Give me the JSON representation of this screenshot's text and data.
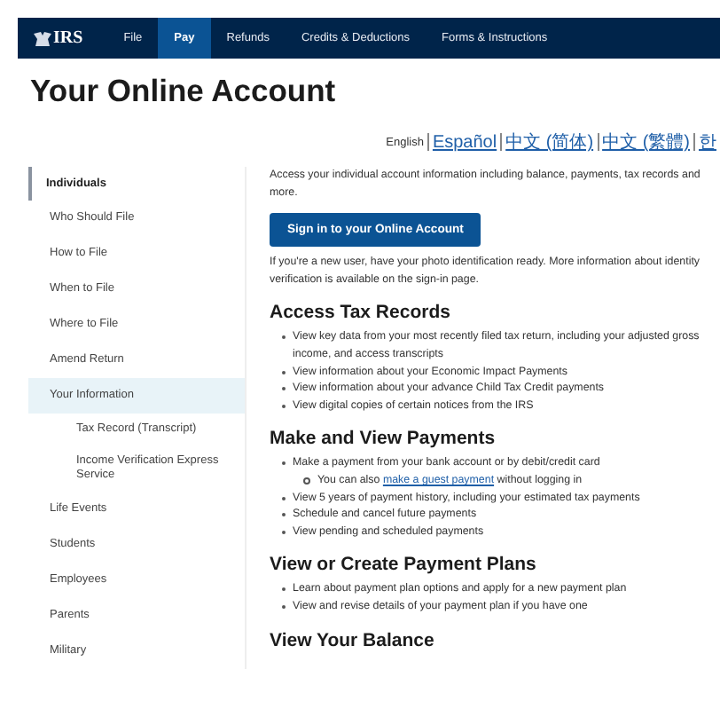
{
  "nav": {
    "logo": "IRS",
    "items": [
      {
        "label": "File",
        "selected": false
      },
      {
        "label": "Pay",
        "selected": true
      },
      {
        "label": "Refunds",
        "selected": false
      },
      {
        "label": "Credits & Deductions",
        "selected": false
      },
      {
        "label": "Forms & Instructions",
        "selected": false
      }
    ]
  },
  "title": "Your Online Account",
  "languages": [
    {
      "label": "English",
      "kind": "current"
    },
    {
      "label": "Español",
      "kind": "link"
    },
    {
      "label": "中文 (简体)",
      "kind": "link"
    },
    {
      "label": "中文 (繁體)",
      "kind": "link"
    },
    {
      "label": "한",
      "kind": "link"
    }
  ],
  "sidebar": {
    "heading": "Individuals",
    "items": [
      {
        "label": "Who Should File",
        "selected": false
      },
      {
        "label": "How to File",
        "selected": false
      },
      {
        "label": "When to File",
        "selected": false
      },
      {
        "label": "Where to File",
        "selected": false
      },
      {
        "label": "Amend Return",
        "selected": false
      },
      {
        "label": "Your Information",
        "selected": true,
        "children": [
          {
            "label": "Tax Record (Transcript)",
            "selected": false
          },
          {
            "label": "Income Verification Express Service",
            "selected": false
          }
        ]
      },
      {
        "label": "Life Events",
        "selected": false
      },
      {
        "label": "Students",
        "selected": false
      },
      {
        "label": "Employees",
        "selected": false
      },
      {
        "label": "Parents",
        "selected": false
      },
      {
        "label": "Military",
        "selected": false
      }
    ]
  },
  "intro": "Access your individual account information including balance, payments, tax records and more.",
  "sign_in_button": "Sign in to your Online Account",
  "note": "If you're a new user, have your photo identification ready. More information about identity verification is available on the sign-in page.",
  "sections": [
    {
      "heading": "Access Tax Records",
      "bullets": [
        {
          "text": "View key data from your most recently filed tax return, including your adjusted gross income, and access transcripts"
        },
        {
          "text": "View information about your Economic Impact Payments"
        },
        {
          "text": "View information about your advance Child Tax Credit payments"
        },
        {
          "text": "View digital copies of certain notices from the IRS"
        }
      ]
    },
    {
      "heading": "Make and View Payments",
      "bullets": [
        {
          "text": "Make a payment from your bank account or by debit/credit card",
          "children": [
            {
              "text": "You can also ",
              "link": "make a guest payment",
              "after": " without logging in"
            }
          ]
        },
        {
          "text": "View 5 years of payment history, including your estimated tax payments"
        },
        {
          "text": "Schedule and cancel future payments"
        },
        {
          "text": "View pending and scheduled payments"
        }
      ]
    },
    {
      "heading": "View or Create Payment Plans",
      "bullets": [
        {
          "text": "Learn about payment plan options and apply for a new payment plan"
        },
        {
          "text": "View and revise details of your payment plan if you have one"
        }
      ]
    },
    {
      "heading": "View Your Balance"
    }
  ]
}
